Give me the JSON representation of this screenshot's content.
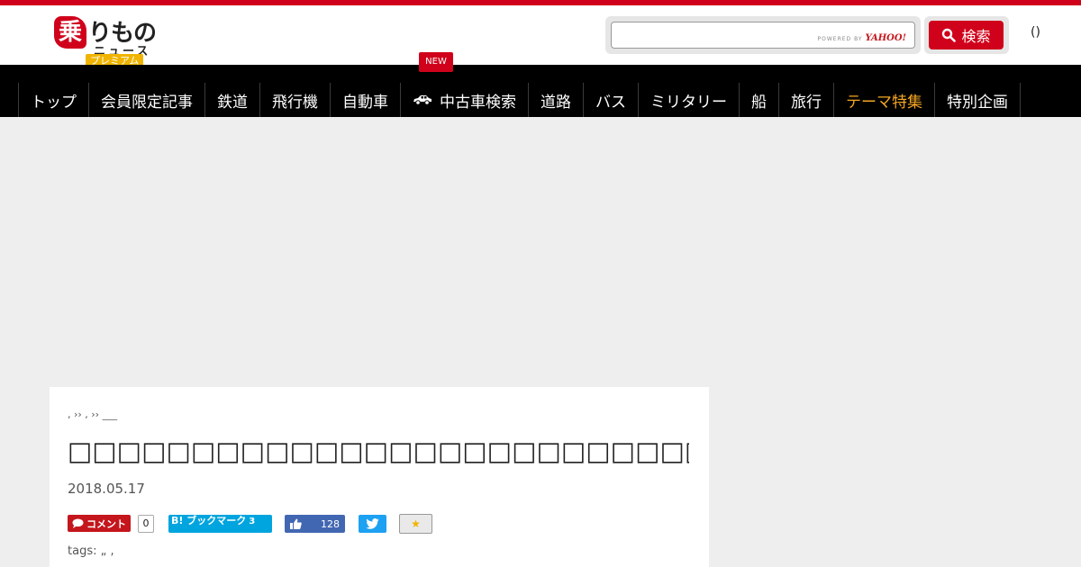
{
  "header": {
    "logo_mark": "乗",
    "logo_text_top": "りもの",
    "logo_text_bottom": "ニュース",
    "logo_badge": "プレミアム",
    "search_placeholder": "",
    "powered_by": "POWERED BY",
    "powered_brand": "YAHOO!",
    "search_button": "検索",
    "user_paren": "()"
  },
  "nav": {
    "new_badge": "NEW",
    "items": [
      {
        "label": "トップ"
      },
      {
        "label": "会員限定記事"
      },
      {
        "label": "鉄道"
      },
      {
        "label": "飛行機"
      },
      {
        "label": "自動車"
      },
      {
        "label": "中古車検索"
      },
      {
        "label": "道路"
      },
      {
        "label": "バス"
      },
      {
        "label": "ミリタリー"
      },
      {
        "label": "船"
      },
      {
        "label": "旅行"
      },
      {
        "label": "テーマ特集"
      },
      {
        "label": "特別企画"
      }
    ],
    "accent_color": "#f5a623"
  },
  "article": {
    "breadcrumb": ", ›› , ›› ___",
    "title": "□□□□□□□□□□□□□□□□□□□□□□□□□□□□□□□□□□□□□□□□□□□□□□□□",
    "date": "2018.05.17",
    "share": {
      "comment_label": "コメント",
      "comment_count": "0",
      "bookmark_label": "B! ブックマーク",
      "bookmark_count": "3",
      "like_count": "128"
    },
    "tags": "tags: „ ,"
  },
  "colors": {
    "brand_red": "#d0021b",
    "twitter": "#1da1f2",
    "facebook": "#4267b2",
    "hatena": "#00a4de"
  }
}
